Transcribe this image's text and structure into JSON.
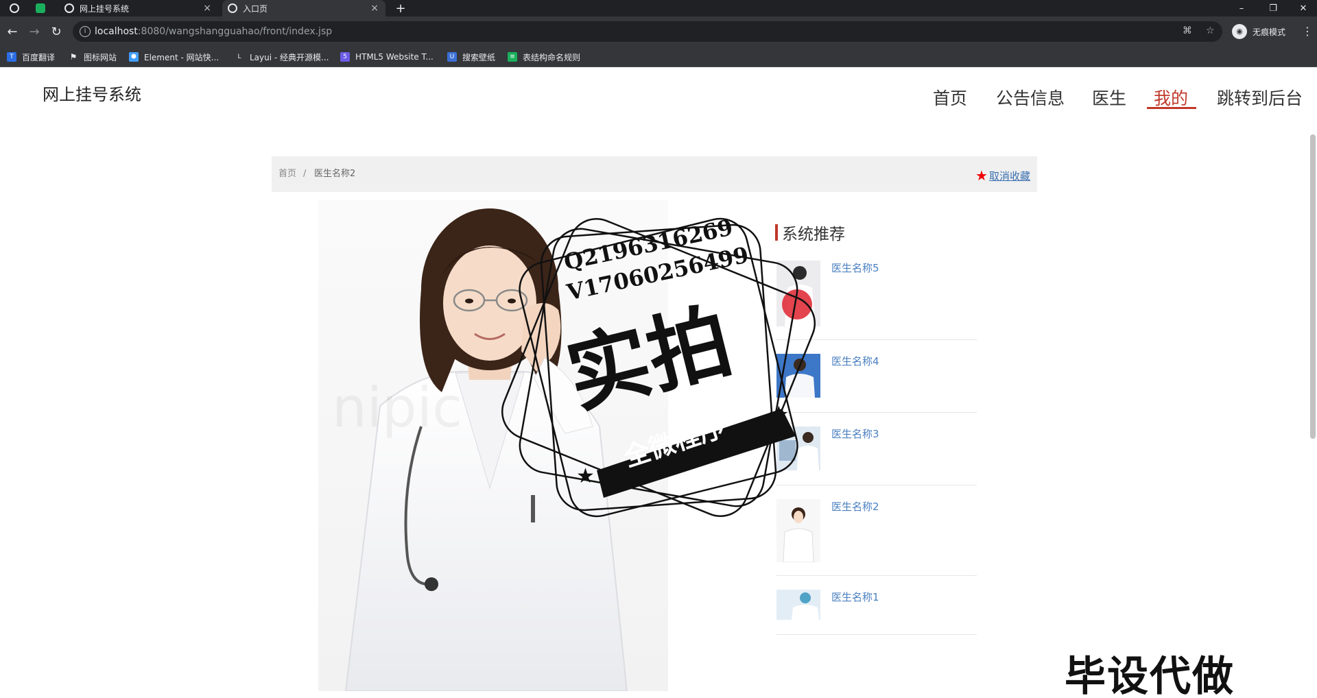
{
  "browser": {
    "tabs": [
      {
        "title": ""
      },
      {
        "title": ""
      },
      {
        "title": "网上挂号系统"
      },
      {
        "title": "入口页"
      }
    ],
    "new_tab_symbol": "+",
    "close_symbol": "×",
    "window_controls": {
      "minimize": "–",
      "restore": "❐",
      "close": "✕"
    },
    "url_host": "localhost",
    "url_rest": ":8080/wangshangguahao/front/index.jsp",
    "incognito_label": "无痕模式",
    "bookmarks": [
      {
        "label": "百度翻译",
        "icon": "baidu-translate-icon",
        "color": "#2b6de5"
      },
      {
        "label": "图标网站",
        "icon": "flag-icon",
        "color": "#35363a"
      },
      {
        "label": "Element - 网站快...",
        "icon": "element-icon",
        "color": "#409eff"
      },
      {
        "label": "Layui - 经典开源模...",
        "icon": "layui-icon",
        "color": "#35363a"
      },
      {
        "label": "HTML5 Website T...",
        "icon": "html5-icon",
        "color": "#6c5ce7"
      },
      {
        "label": "搜索壁纸",
        "icon": "wallpaper-icon",
        "color": "#3c6fd6"
      },
      {
        "label": "表结构命名规则",
        "icon": "sheet-icon",
        "color": "#1aaf5d"
      }
    ]
  },
  "header": {
    "site_title": "网上挂号系统",
    "nav": [
      {
        "label": "首页"
      },
      {
        "label": "公告信息"
      },
      {
        "label": "医生"
      },
      {
        "label": "我的"
      },
      {
        "label": "跳转到后台"
      }
    ],
    "active_nav": "我的",
    "accent_color": "#c0392b"
  },
  "breadcrumb": {
    "home": "首页",
    "separator": "/",
    "current": "医生名称2",
    "favorite_label": "取消收藏",
    "favorite_icon": "star-icon"
  },
  "sidebar": {
    "title": "系统推荐",
    "items": [
      {
        "name": "医生名称5"
      },
      {
        "name": "医生名称4"
      },
      {
        "name": "医生名称3"
      },
      {
        "name": "医生名称2"
      },
      {
        "name": "医生名称1"
      }
    ]
  },
  "watermark": {
    "line1": "Q2196316269",
    "line2": "V1706025649​9",
    "big": "实拍",
    "banner": "全微程序",
    "corner": "毕设代做"
  }
}
